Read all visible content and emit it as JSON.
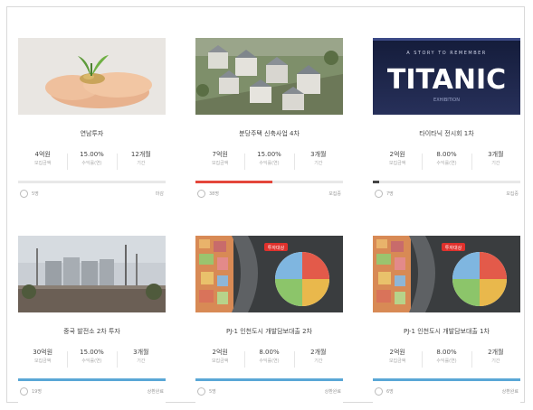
{
  "cards": [
    {
      "title": "연남투자",
      "stats": [
        {
          "value": "4억원",
          "label": "모집금액"
        },
        {
          "value": "15.00%",
          "label": "수익률(연)"
        },
        {
          "value": "12개월",
          "label": "기간"
        }
      ],
      "progress": 0.0,
      "bar_color": "#e8e8e8",
      "footer_left": "5명",
      "footer_right": "마감"
    },
    {
      "title": "분당주택 신축사업 4차",
      "stats": [
        {
          "value": "7억원",
          "label": "모집금액"
        },
        {
          "value": "15.00%",
          "label": "수익률(연)"
        },
        {
          "value": "3개월",
          "label": "기간"
        }
      ],
      "progress": 0.52,
      "bar_color": "#e4463b",
      "footer_left": "38명",
      "footer_right": "모집중"
    },
    {
      "title": "타이타닉 전시회 1차",
      "stats": [
        {
          "value": "2억원",
          "label": "모집금액"
        },
        {
          "value": "8.00%",
          "label": "수익률(연)"
        },
        {
          "value": "3개월",
          "label": "기간"
        }
      ],
      "progress": 0.04,
      "bar_color": "#444444",
      "footer_left": "7명",
      "footer_right": "모집중"
    },
    {
      "title": "중국 발전소 2차 투자",
      "stats": [
        {
          "value": "30억원",
          "label": "모집금액"
        },
        {
          "value": "15.00%",
          "label": "수익률(연)"
        },
        {
          "value": "3개월",
          "label": "기간"
        }
      ],
      "progress": 1.0,
      "bar_color": "#5aa7d6",
      "footer_left": "19명",
      "footer_right": "상환완료"
    },
    {
      "title": "PJ-1 인천도시 개발담보대출 2차",
      "stats": [
        {
          "value": "2억원",
          "label": "모집금액"
        },
        {
          "value": "8.00%",
          "label": "수익률(연)"
        },
        {
          "value": "2개월",
          "label": "기간"
        }
      ],
      "progress": 1.0,
      "bar_color": "#5aa7d6",
      "footer_left": "5명",
      "footer_right": "상환완료"
    },
    {
      "title": "PJ-1 인천도시 개발담보대출 1차",
      "stats": [
        {
          "value": "2억원",
          "label": "모집금액"
        },
        {
          "value": "8.00%",
          "label": "수익률(연)"
        },
        {
          "value": "2개월",
          "label": "기간"
        }
      ],
      "progress": 1.0,
      "bar_color": "#5aa7d6",
      "footer_left": "6명",
      "footer_right": "상환완료"
    }
  ],
  "titanic_banner": {
    "small_text": "A STORY TO REMEMBER",
    "big_text": "TITANIC",
    "sub_text": "EXHIBITION"
  },
  "map_badge": "투자대상"
}
